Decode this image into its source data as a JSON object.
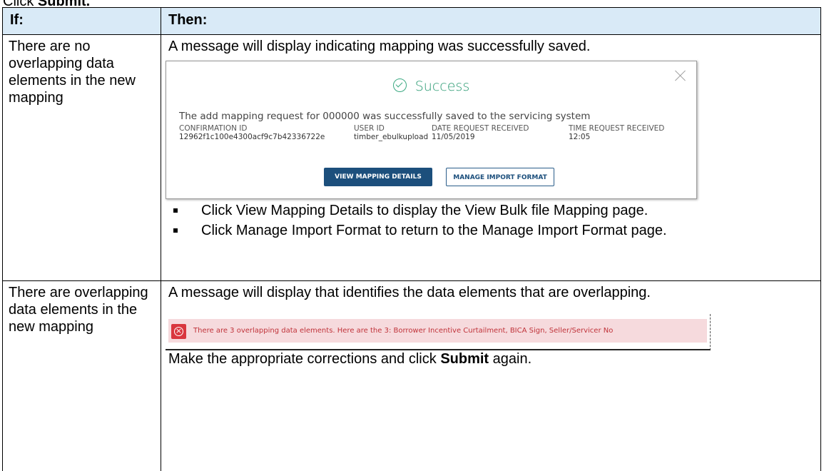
{
  "top_line": {
    "prefix": "Click ",
    "bold": "Submit."
  },
  "table": {
    "headers": [
      "If:",
      "Then:"
    ],
    "rows": [
      {
        "condition": "There are no overlapping data elements in the new mapping",
        "result": "A message will display indicating mapping was successfully saved.",
        "success_dialog": {
          "title": "Success",
          "message": "The add mapping request for 000000 was successfully saved to the servicing system",
          "fields": [
            {
              "label": "CONFIRMATION ID",
              "value": "12962f1c100e4300acf9c7b42336722e"
            },
            {
              "label": "USER ID",
              "value": "timber_ebulkupload"
            },
            {
              "label": "DATE REQUEST RECEIVED",
              "value": "11/05/2019"
            },
            {
              "label": "TIME REQUEST RECEIVED",
              "value": "12:05"
            }
          ],
          "primary_button": "VIEW MAPPING DETAILS",
          "secondary_button": "MANAGE IMPORT FORMAT"
        },
        "bullets": [
          "Click View Mapping Details to display the View Bulk file Mapping page.",
          "Click Manage Import Format to return to the Manage Import Format page."
        ]
      },
      {
        "condition": "There are overlapping data elements in the new mapping",
        "result": "A message will display that identifies the data elements that are overlapping.",
        "error_banner": {
          "message": "There are 3 overlapping data elements. Here are the 3: Borrower Incentive Curtailment, BICA Sign, Seller/Servicer No"
        },
        "final_prefix": "Make the appropriate corrections and click ",
        "final_bold": "Submit",
        "final_suffix": " again."
      }
    ]
  }
}
